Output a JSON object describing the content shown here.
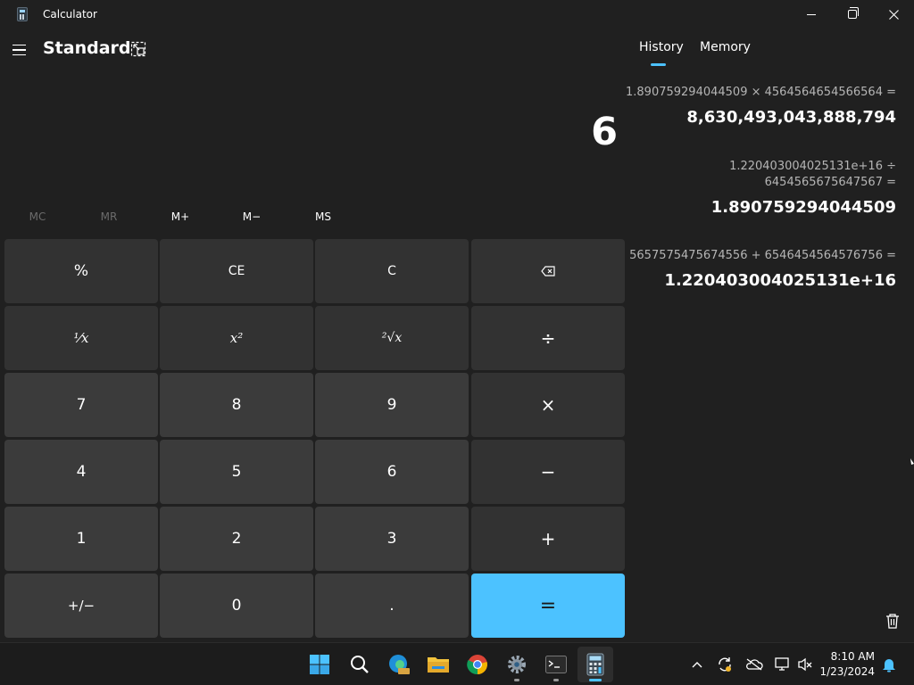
{
  "window": {
    "title": "Calculator",
    "controls": {
      "minimize": "minimize",
      "maximize": "restore",
      "close": "close"
    }
  },
  "header": {
    "mode": "Standard"
  },
  "display": {
    "value": "6"
  },
  "memory": {
    "buttons": [
      {
        "label": "MC",
        "enabled": false
      },
      {
        "label": "MR",
        "enabled": false
      },
      {
        "label": "M+",
        "enabled": true
      },
      {
        "label": "M−",
        "enabled": true
      },
      {
        "label": "MS",
        "enabled": true
      }
    ]
  },
  "keypad": {
    "percent": "%",
    "ce": "CE",
    "clear": "C",
    "backspace": "⌫",
    "reciprocal": "⅟x",
    "square": "x²",
    "sqrt": "²√x",
    "divide": "÷",
    "seven": "7",
    "eight": "8",
    "nine": "9",
    "multiply": "×",
    "four": "4",
    "five": "5",
    "six": "6",
    "subtract": "−",
    "one": "1",
    "two": "2",
    "three": "3",
    "add": "+",
    "negate": "+/−",
    "zero": "0",
    "decimal": ".",
    "equals": "="
  },
  "panel": {
    "tabs": [
      "History",
      "Memory"
    ],
    "active_tab": "History",
    "history": [
      {
        "expr_line1": "1.890759294044509   ×   4564564654566564 =",
        "expr_line2": "",
        "result": "8,630,493,043,888,794"
      },
      {
        "expr_line1": "1.220403004025131e+16   ÷",
        "expr_line2": "6454565675647567 =",
        "result": "1.890759294044509"
      },
      {
        "expr_line1": "5657575475674556   +   6546454564576756 =",
        "expr_line2": "",
        "result": "1.220403004025131e+16"
      }
    ],
    "clear_history_icon": "trash-icon"
  },
  "taskbar": {
    "apps": [
      "start",
      "search",
      "edge-beta",
      "file-explorer",
      "chrome",
      "settings",
      "terminal",
      "calculator"
    ],
    "active_app": "calculator",
    "clock": {
      "time": "8:10 AM",
      "date": "1/23/2024"
    }
  },
  "colors": {
    "background": "#202020",
    "key_number": "#3b3b3b",
    "key_operator": "#323232",
    "accent": "#4cc2ff",
    "taskbar": "#1c1c1c"
  }
}
